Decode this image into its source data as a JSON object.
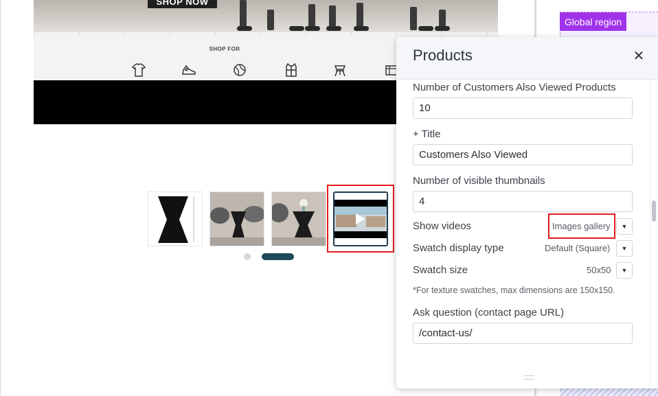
{
  "preview": {
    "hero_button_label": "SHOP NOW",
    "shop_for_label": "SHOP FOR",
    "category_icons": [
      "shirt-icon",
      "shoe-icon",
      "ball-icon",
      "vest-icon",
      "chair-icon",
      "more-icon"
    ],
    "thumbnails": [
      {
        "name": "product-thumbnail-1",
        "kind": "dimension drawing"
      },
      {
        "name": "product-thumbnail-2",
        "kind": "lifestyle photo"
      },
      {
        "name": "product-thumbnail-3",
        "kind": "lifestyle photo"
      },
      {
        "name": "product-thumbnail-video",
        "kind": "video"
      }
    ],
    "selected_thumbnail_index": 3
  },
  "global_region": {
    "label": "Global region",
    "accent_color": "#a033ea"
  },
  "panel": {
    "title": "Products",
    "fields": {
      "also_viewed_count": {
        "label": "Number of Customers Also Viewed Products",
        "value": "10"
      },
      "title": {
        "label": "+ Title",
        "value": "Customers Also Viewed"
      },
      "visible_thumbnails": {
        "label": "Number of visible thumbnails",
        "value": "4"
      },
      "show_videos": {
        "label": "Show videos",
        "value": "Images gallery"
      },
      "swatch_display_type": {
        "label": "Swatch display type",
        "value": "Default (Square)"
      },
      "swatch_size": {
        "label": "Swatch size",
        "value": "50x50"
      },
      "texture_note": "*For texture swatches, max dimensions are 150x150.",
      "ask_question": {
        "label": "Ask question (contact page URL)",
        "value": "/contact-us/"
      }
    }
  },
  "colors": {
    "highlight_red": "#e31b1b",
    "carousel_active": "#1e4a5a"
  }
}
